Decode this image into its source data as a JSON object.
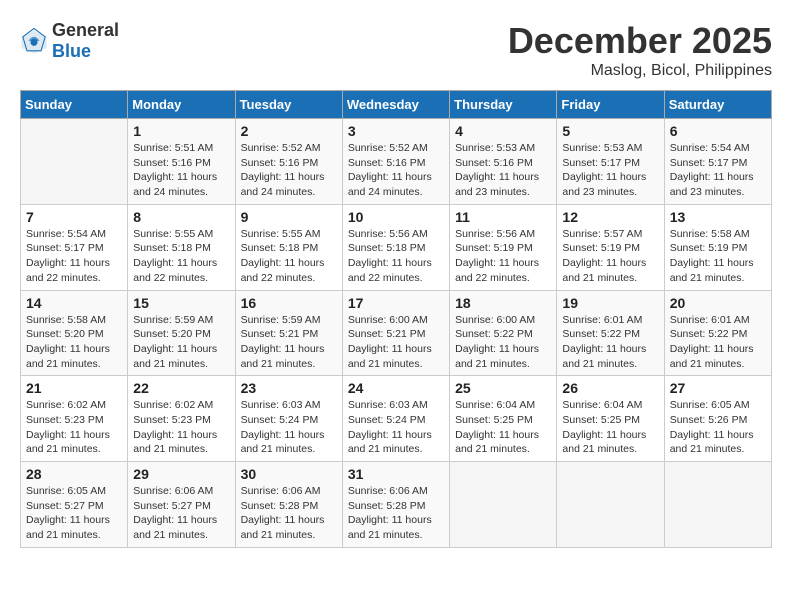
{
  "logo": {
    "general": "General",
    "blue": "Blue"
  },
  "title": "December 2025",
  "location": "Maslog, Bicol, Philippines",
  "days_of_week": [
    "Sunday",
    "Monday",
    "Tuesday",
    "Wednesday",
    "Thursday",
    "Friday",
    "Saturday"
  ],
  "weeks": [
    [
      {
        "num": "",
        "sunrise": "",
        "sunset": "",
        "daylight": ""
      },
      {
        "num": "1",
        "sunrise": "Sunrise: 5:51 AM",
        "sunset": "Sunset: 5:16 PM",
        "daylight": "Daylight: 11 hours and 24 minutes."
      },
      {
        "num": "2",
        "sunrise": "Sunrise: 5:52 AM",
        "sunset": "Sunset: 5:16 PM",
        "daylight": "Daylight: 11 hours and 24 minutes."
      },
      {
        "num": "3",
        "sunrise": "Sunrise: 5:52 AM",
        "sunset": "Sunset: 5:16 PM",
        "daylight": "Daylight: 11 hours and 24 minutes."
      },
      {
        "num": "4",
        "sunrise": "Sunrise: 5:53 AM",
        "sunset": "Sunset: 5:16 PM",
        "daylight": "Daylight: 11 hours and 23 minutes."
      },
      {
        "num": "5",
        "sunrise": "Sunrise: 5:53 AM",
        "sunset": "Sunset: 5:17 PM",
        "daylight": "Daylight: 11 hours and 23 minutes."
      },
      {
        "num": "6",
        "sunrise": "Sunrise: 5:54 AM",
        "sunset": "Sunset: 5:17 PM",
        "daylight": "Daylight: 11 hours and 23 minutes."
      }
    ],
    [
      {
        "num": "7",
        "sunrise": "Sunrise: 5:54 AM",
        "sunset": "Sunset: 5:17 PM",
        "daylight": "Daylight: 11 hours and 22 minutes."
      },
      {
        "num": "8",
        "sunrise": "Sunrise: 5:55 AM",
        "sunset": "Sunset: 5:18 PM",
        "daylight": "Daylight: 11 hours and 22 minutes."
      },
      {
        "num": "9",
        "sunrise": "Sunrise: 5:55 AM",
        "sunset": "Sunset: 5:18 PM",
        "daylight": "Daylight: 11 hours and 22 minutes."
      },
      {
        "num": "10",
        "sunrise": "Sunrise: 5:56 AM",
        "sunset": "Sunset: 5:18 PM",
        "daylight": "Daylight: 11 hours and 22 minutes."
      },
      {
        "num": "11",
        "sunrise": "Sunrise: 5:56 AM",
        "sunset": "Sunset: 5:19 PM",
        "daylight": "Daylight: 11 hours and 22 minutes."
      },
      {
        "num": "12",
        "sunrise": "Sunrise: 5:57 AM",
        "sunset": "Sunset: 5:19 PM",
        "daylight": "Daylight: 11 hours and 21 minutes."
      },
      {
        "num": "13",
        "sunrise": "Sunrise: 5:58 AM",
        "sunset": "Sunset: 5:19 PM",
        "daylight": "Daylight: 11 hours and 21 minutes."
      }
    ],
    [
      {
        "num": "14",
        "sunrise": "Sunrise: 5:58 AM",
        "sunset": "Sunset: 5:20 PM",
        "daylight": "Daylight: 11 hours and 21 minutes."
      },
      {
        "num": "15",
        "sunrise": "Sunrise: 5:59 AM",
        "sunset": "Sunset: 5:20 PM",
        "daylight": "Daylight: 11 hours and 21 minutes."
      },
      {
        "num": "16",
        "sunrise": "Sunrise: 5:59 AM",
        "sunset": "Sunset: 5:21 PM",
        "daylight": "Daylight: 11 hours and 21 minutes."
      },
      {
        "num": "17",
        "sunrise": "Sunrise: 6:00 AM",
        "sunset": "Sunset: 5:21 PM",
        "daylight": "Daylight: 11 hours and 21 minutes."
      },
      {
        "num": "18",
        "sunrise": "Sunrise: 6:00 AM",
        "sunset": "Sunset: 5:22 PM",
        "daylight": "Daylight: 11 hours and 21 minutes."
      },
      {
        "num": "19",
        "sunrise": "Sunrise: 6:01 AM",
        "sunset": "Sunset: 5:22 PM",
        "daylight": "Daylight: 11 hours and 21 minutes."
      },
      {
        "num": "20",
        "sunrise": "Sunrise: 6:01 AM",
        "sunset": "Sunset: 5:22 PM",
        "daylight": "Daylight: 11 hours and 21 minutes."
      }
    ],
    [
      {
        "num": "21",
        "sunrise": "Sunrise: 6:02 AM",
        "sunset": "Sunset: 5:23 PM",
        "daylight": "Daylight: 11 hours and 21 minutes."
      },
      {
        "num": "22",
        "sunrise": "Sunrise: 6:02 AM",
        "sunset": "Sunset: 5:23 PM",
        "daylight": "Daylight: 11 hours and 21 minutes."
      },
      {
        "num": "23",
        "sunrise": "Sunrise: 6:03 AM",
        "sunset": "Sunset: 5:24 PM",
        "daylight": "Daylight: 11 hours and 21 minutes."
      },
      {
        "num": "24",
        "sunrise": "Sunrise: 6:03 AM",
        "sunset": "Sunset: 5:24 PM",
        "daylight": "Daylight: 11 hours and 21 minutes."
      },
      {
        "num": "25",
        "sunrise": "Sunrise: 6:04 AM",
        "sunset": "Sunset: 5:25 PM",
        "daylight": "Daylight: 11 hours and 21 minutes."
      },
      {
        "num": "26",
        "sunrise": "Sunrise: 6:04 AM",
        "sunset": "Sunset: 5:25 PM",
        "daylight": "Daylight: 11 hours and 21 minutes."
      },
      {
        "num": "27",
        "sunrise": "Sunrise: 6:05 AM",
        "sunset": "Sunset: 5:26 PM",
        "daylight": "Daylight: 11 hours and 21 minutes."
      }
    ],
    [
      {
        "num": "28",
        "sunrise": "Sunrise: 6:05 AM",
        "sunset": "Sunset: 5:27 PM",
        "daylight": "Daylight: 11 hours and 21 minutes."
      },
      {
        "num": "29",
        "sunrise": "Sunrise: 6:06 AM",
        "sunset": "Sunset: 5:27 PM",
        "daylight": "Daylight: 11 hours and 21 minutes."
      },
      {
        "num": "30",
        "sunrise": "Sunrise: 6:06 AM",
        "sunset": "Sunset: 5:28 PM",
        "daylight": "Daylight: 11 hours and 21 minutes."
      },
      {
        "num": "31",
        "sunrise": "Sunrise: 6:06 AM",
        "sunset": "Sunset: 5:28 PM",
        "daylight": "Daylight: 11 hours and 21 minutes."
      },
      {
        "num": "",
        "sunrise": "",
        "sunset": "",
        "daylight": ""
      },
      {
        "num": "",
        "sunrise": "",
        "sunset": "",
        "daylight": ""
      },
      {
        "num": "",
        "sunrise": "",
        "sunset": "",
        "daylight": ""
      }
    ]
  ]
}
